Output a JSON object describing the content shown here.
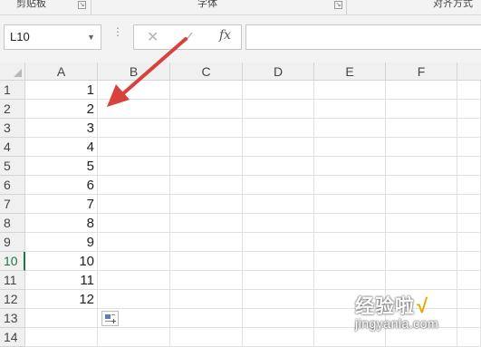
{
  "ribbon": {
    "groups": [
      "剪贴板",
      "字体",
      "对齐方式"
    ],
    "launcher_glyph": "↘"
  },
  "formula_bar": {
    "name_box": "L10",
    "name_dropdown_glyph": "▼",
    "more_glyph": "⋮",
    "cancel_glyph": "✕",
    "enter_glyph": "✓",
    "fx_label": "fx",
    "formula_value": ""
  },
  "grid": {
    "columns": [
      "A",
      "B",
      "C",
      "D",
      "E",
      "F",
      ""
    ],
    "rows": [
      "1",
      "2",
      "3",
      "4",
      "5",
      "6",
      "7",
      "8",
      "9",
      "10",
      "11",
      "12",
      "13",
      "14"
    ],
    "selected_row": "10",
    "column_a_values": [
      "1",
      "2",
      "3",
      "4",
      "5",
      "6",
      "7",
      "8",
      "9",
      "10",
      "11",
      "12",
      "",
      ""
    ]
  },
  "annotation": {
    "arrow_color": "#d9413d"
  },
  "watermark": {
    "chinese": "经验啦",
    "check": "√",
    "url": "jingyanla.com"
  },
  "colors": {
    "header_bg": "#f0f0f0",
    "selection_green": "#217346",
    "gridline": "#e1e1e1"
  }
}
